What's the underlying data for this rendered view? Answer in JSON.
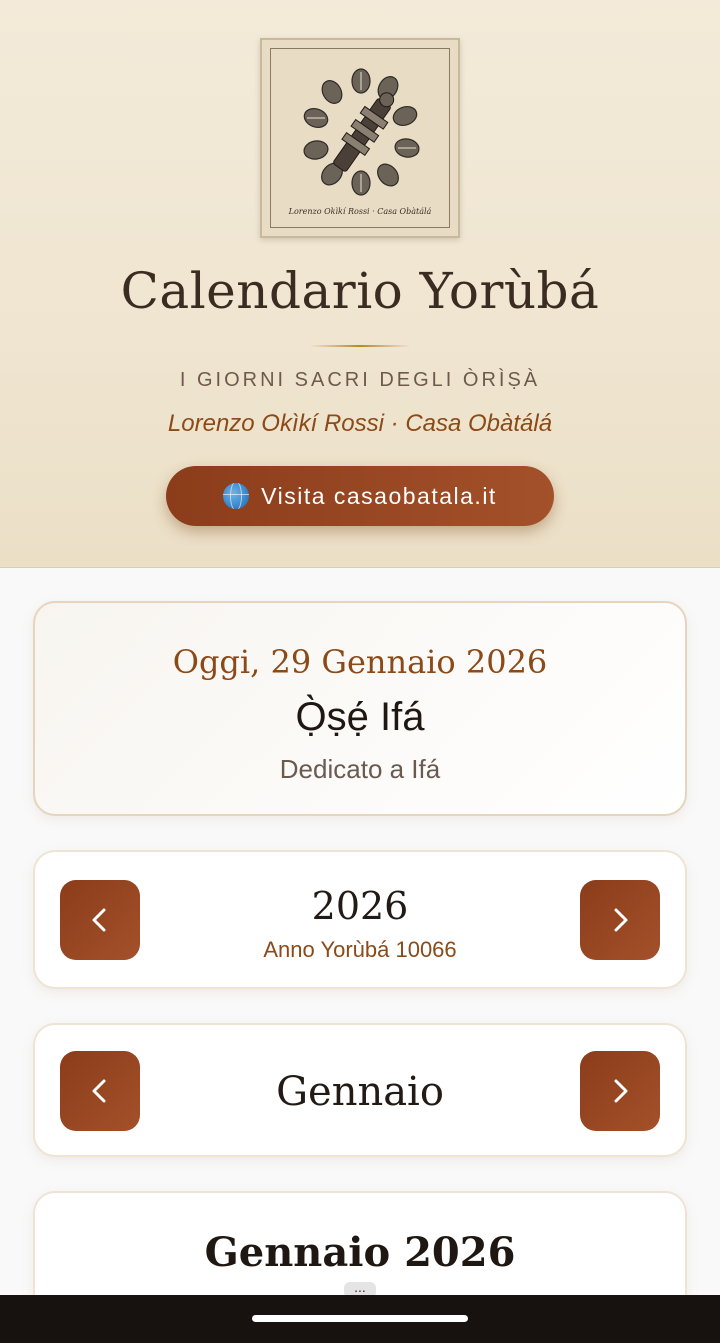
{
  "header": {
    "logo_caption": "Lorenzo Okìkí Rossi · Casa Obàtálá",
    "title": "Calendario Yorùbá",
    "subtitle": "I GIORNI SACRI DEGLI ÒRÌṢÀ",
    "author": "Lorenzo Okìkí Rossi · Casa Obàtálá",
    "visit_button": {
      "icon": "globe-icon",
      "label": "Visita casaobatala.it"
    }
  },
  "today": {
    "date": "Oggi, 29 Gennaio 2026",
    "day_name": "Ọ̀ṣẹ́ Ifá",
    "dedication": "Dedicato a Ifá"
  },
  "year_nav": {
    "prev_icon": "chevron-left-icon",
    "next_icon": "chevron-right-icon",
    "year": "2026",
    "yoruba_year": "Anno Yorùbá 10066"
  },
  "month_nav": {
    "prev_icon": "chevron-left-icon",
    "next_icon": "chevron-right-icon",
    "month": "Gennaio"
  },
  "calendar": {
    "title": "Gennaio 2026"
  },
  "overlay": {
    "more_label": "..."
  },
  "colors": {
    "accent": "#8b3c1a",
    "accent_text": "#8b4a18",
    "header_bg": "#f3ead9",
    "page_bg": "#f9f9f9",
    "nav_bar": "#17110f"
  }
}
